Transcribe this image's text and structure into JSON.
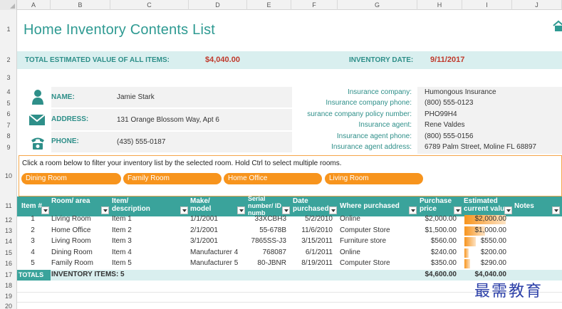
{
  "columns": [
    "A",
    "B",
    "C",
    "D",
    "E",
    "F",
    "G",
    "H",
    "I",
    "J"
  ],
  "rows": [
    "1",
    "2",
    "3",
    "4",
    "5",
    "6",
    "7",
    "8",
    "9",
    "10",
    "11",
    "12",
    "13",
    "14",
    "15",
    "16",
    "17",
    "18",
    "19",
    "20"
  ],
  "title": "Home Inventory Contents List",
  "summary": {
    "total_label": "TOTAL ESTIMATED VALUE OF ALL ITEMS:",
    "total_value": "$4,040.00",
    "date_label": "INVENTORY DATE:",
    "date_value": "9/11/2017"
  },
  "owner": {
    "name_label": "NAME:",
    "name_value": "Jamie Stark",
    "address_label": "ADDRESS:",
    "address_value": "131 Orange Blossom Way, Apt 6",
    "phone_label": "PHONE:",
    "phone_value": "(435) 555-0187"
  },
  "insurance": [
    {
      "label": "Insurance company:",
      "value": "Humongous Insurance"
    },
    {
      "label": "Insurance company phone:",
      "value": "(800) 555-0123"
    },
    {
      "label": "surance company policy number:",
      "value": "PHO99H4"
    },
    {
      "label": "Insurance agent:",
      "value": "Rene Valdes"
    },
    {
      "label": "Insurance agent phone:",
      "value": "(800) 555-0156"
    },
    {
      "label": "Insurance agent address:",
      "value": "6789 Palm Street, Moline FL 68897"
    }
  ],
  "filter": {
    "instruction": "Click a room below to filter your inventory list by the selected room. Hold Ctrl to select multiple rooms.",
    "rooms": [
      "Dining Room",
      "Family Room",
      "Home Office",
      "Living Room"
    ]
  },
  "table": {
    "headers": {
      "item": "Item #",
      "room": "Room/ area",
      "desc": "Item/ description",
      "make": "Make/ model",
      "serial": "Serial number/ ID numb",
      "date": "Date purchased",
      "where": "Where purchased",
      "price": "Purchase price",
      "est": "Estimated current valu",
      "notes": "Notes"
    },
    "rows": [
      {
        "item": "1",
        "room": "Living Room",
        "desc": "Item 1",
        "make": "1/1/2001",
        "serial": "33XCBH3",
        "date": "5/2/2010",
        "where": "Online",
        "price": "$2,000.00",
        "est": "$2,000.00",
        "est_fraction": 1.0
      },
      {
        "item": "2",
        "room": "Home Office",
        "desc": "Item 2",
        "make": "2/1/2001",
        "serial": "55-678B",
        "date": "11/6/2010",
        "where": "Computer Store",
        "price": "$1,500.00",
        "est": "$1,000.00",
        "est_fraction": 0.5
      },
      {
        "item": "3",
        "room": "Living Room",
        "desc": "Item 3",
        "make": "3/1/2001",
        "serial": "7865SS-J3",
        "date": "3/15/2011",
        "where": "Furniture store",
        "price": "$560.00",
        "est": "$550.00",
        "est_fraction": 0.275
      },
      {
        "item": "4",
        "room": "Dining Room",
        "desc": "Item 4",
        "make": "Manufacturer 4",
        "serial": "768087",
        "date": "6/1/2011",
        "where": "Online",
        "price": "$240.00",
        "est": "$200.00",
        "est_fraction": 0.1
      },
      {
        "item": "5",
        "room": "Family Room",
        "desc": "Item 5",
        "make": "Manufacturer 5",
        "serial": "80-JBNR",
        "date": "8/19/2011",
        "where": "Computer Store",
        "price": "$350.00",
        "est": "$290.00",
        "est_fraction": 0.145
      }
    ],
    "totals": {
      "label": "TOTALS",
      "items": "INVENTORY ITEMS: 5",
      "price": "$4,600.00",
      "est": "$4,040.00"
    }
  },
  "watermark": "最需教育",
  "colors": {
    "teal": "#3aa39b",
    "teal_light": "#d9efef",
    "orange": "#f7941d",
    "red": "#c0392b"
  }
}
